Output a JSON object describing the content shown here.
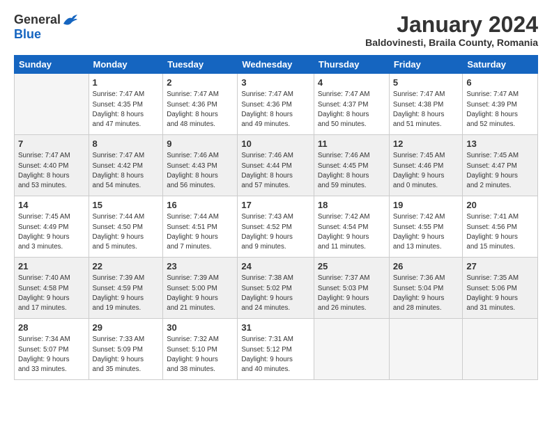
{
  "logo": {
    "general": "General",
    "blue": "Blue"
  },
  "title": "January 2024",
  "subtitle": "Baldovinesti, Braila County, Romania",
  "weekdays": [
    "Sunday",
    "Monday",
    "Tuesday",
    "Wednesday",
    "Thursday",
    "Friday",
    "Saturday"
  ],
  "weeks": [
    [
      {
        "day": "",
        "sunrise": "",
        "sunset": "",
        "daylight": "",
        "empty": true
      },
      {
        "day": "1",
        "sunrise": "Sunrise: 7:47 AM",
        "sunset": "Sunset: 4:35 PM",
        "daylight": "Daylight: 8 hours and 47 minutes."
      },
      {
        "day": "2",
        "sunrise": "Sunrise: 7:47 AM",
        "sunset": "Sunset: 4:36 PM",
        "daylight": "Daylight: 8 hours and 48 minutes."
      },
      {
        "day": "3",
        "sunrise": "Sunrise: 7:47 AM",
        "sunset": "Sunset: 4:36 PM",
        "daylight": "Daylight: 8 hours and 49 minutes."
      },
      {
        "day": "4",
        "sunrise": "Sunrise: 7:47 AM",
        "sunset": "Sunset: 4:37 PM",
        "daylight": "Daylight: 8 hours and 50 minutes."
      },
      {
        "day": "5",
        "sunrise": "Sunrise: 7:47 AM",
        "sunset": "Sunset: 4:38 PM",
        "daylight": "Daylight: 8 hours and 51 minutes."
      },
      {
        "day": "6",
        "sunrise": "Sunrise: 7:47 AM",
        "sunset": "Sunset: 4:39 PM",
        "daylight": "Daylight: 8 hours and 52 minutes."
      }
    ],
    [
      {
        "day": "7",
        "sunrise": "Sunrise: 7:47 AM",
        "sunset": "Sunset: 4:40 PM",
        "daylight": "Daylight: 8 hours and 53 minutes."
      },
      {
        "day": "8",
        "sunrise": "Sunrise: 7:47 AM",
        "sunset": "Sunset: 4:42 PM",
        "daylight": "Daylight: 8 hours and 54 minutes."
      },
      {
        "day": "9",
        "sunrise": "Sunrise: 7:46 AM",
        "sunset": "Sunset: 4:43 PM",
        "daylight": "Daylight: 8 hours and 56 minutes."
      },
      {
        "day": "10",
        "sunrise": "Sunrise: 7:46 AM",
        "sunset": "Sunset: 4:44 PM",
        "daylight": "Daylight: 8 hours and 57 minutes."
      },
      {
        "day": "11",
        "sunrise": "Sunrise: 7:46 AM",
        "sunset": "Sunset: 4:45 PM",
        "daylight": "Daylight: 8 hours and 59 minutes."
      },
      {
        "day": "12",
        "sunrise": "Sunrise: 7:45 AM",
        "sunset": "Sunset: 4:46 PM",
        "daylight": "Daylight: 9 hours and 0 minutes."
      },
      {
        "day": "13",
        "sunrise": "Sunrise: 7:45 AM",
        "sunset": "Sunset: 4:47 PM",
        "daylight": "Daylight: 9 hours and 2 minutes."
      }
    ],
    [
      {
        "day": "14",
        "sunrise": "Sunrise: 7:45 AM",
        "sunset": "Sunset: 4:49 PM",
        "daylight": "Daylight: 9 hours and 3 minutes."
      },
      {
        "day": "15",
        "sunrise": "Sunrise: 7:44 AM",
        "sunset": "Sunset: 4:50 PM",
        "daylight": "Daylight: 9 hours and 5 minutes."
      },
      {
        "day": "16",
        "sunrise": "Sunrise: 7:44 AM",
        "sunset": "Sunset: 4:51 PM",
        "daylight": "Daylight: 9 hours and 7 minutes."
      },
      {
        "day": "17",
        "sunrise": "Sunrise: 7:43 AM",
        "sunset": "Sunset: 4:52 PM",
        "daylight": "Daylight: 9 hours and 9 minutes."
      },
      {
        "day": "18",
        "sunrise": "Sunrise: 7:42 AM",
        "sunset": "Sunset: 4:54 PM",
        "daylight": "Daylight: 9 hours and 11 minutes."
      },
      {
        "day": "19",
        "sunrise": "Sunrise: 7:42 AM",
        "sunset": "Sunset: 4:55 PM",
        "daylight": "Daylight: 9 hours and 13 minutes."
      },
      {
        "day": "20",
        "sunrise": "Sunrise: 7:41 AM",
        "sunset": "Sunset: 4:56 PM",
        "daylight": "Daylight: 9 hours and 15 minutes."
      }
    ],
    [
      {
        "day": "21",
        "sunrise": "Sunrise: 7:40 AM",
        "sunset": "Sunset: 4:58 PM",
        "daylight": "Daylight: 9 hours and 17 minutes."
      },
      {
        "day": "22",
        "sunrise": "Sunrise: 7:39 AM",
        "sunset": "Sunset: 4:59 PM",
        "daylight": "Daylight: 9 hours and 19 minutes."
      },
      {
        "day": "23",
        "sunrise": "Sunrise: 7:39 AM",
        "sunset": "Sunset: 5:00 PM",
        "daylight": "Daylight: 9 hours and 21 minutes."
      },
      {
        "day": "24",
        "sunrise": "Sunrise: 7:38 AM",
        "sunset": "Sunset: 5:02 PM",
        "daylight": "Daylight: 9 hours and 24 minutes."
      },
      {
        "day": "25",
        "sunrise": "Sunrise: 7:37 AM",
        "sunset": "Sunset: 5:03 PM",
        "daylight": "Daylight: 9 hours and 26 minutes."
      },
      {
        "day": "26",
        "sunrise": "Sunrise: 7:36 AM",
        "sunset": "Sunset: 5:04 PM",
        "daylight": "Daylight: 9 hours and 28 minutes."
      },
      {
        "day": "27",
        "sunrise": "Sunrise: 7:35 AM",
        "sunset": "Sunset: 5:06 PM",
        "daylight": "Daylight: 9 hours and 31 minutes."
      }
    ],
    [
      {
        "day": "28",
        "sunrise": "Sunrise: 7:34 AM",
        "sunset": "Sunset: 5:07 PM",
        "daylight": "Daylight: 9 hours and 33 minutes."
      },
      {
        "day": "29",
        "sunrise": "Sunrise: 7:33 AM",
        "sunset": "Sunset: 5:09 PM",
        "daylight": "Daylight: 9 hours and 35 minutes."
      },
      {
        "day": "30",
        "sunrise": "Sunrise: 7:32 AM",
        "sunset": "Sunset: 5:10 PM",
        "daylight": "Daylight: 9 hours and 38 minutes."
      },
      {
        "day": "31",
        "sunrise": "Sunrise: 7:31 AM",
        "sunset": "Sunset: 5:12 PM",
        "daylight": "Daylight: 9 hours and 40 minutes."
      },
      {
        "day": "",
        "sunrise": "",
        "sunset": "",
        "daylight": "",
        "empty": true
      },
      {
        "day": "",
        "sunrise": "",
        "sunset": "",
        "daylight": "",
        "empty": true
      },
      {
        "day": "",
        "sunrise": "",
        "sunset": "",
        "daylight": "",
        "empty": true
      }
    ]
  ]
}
